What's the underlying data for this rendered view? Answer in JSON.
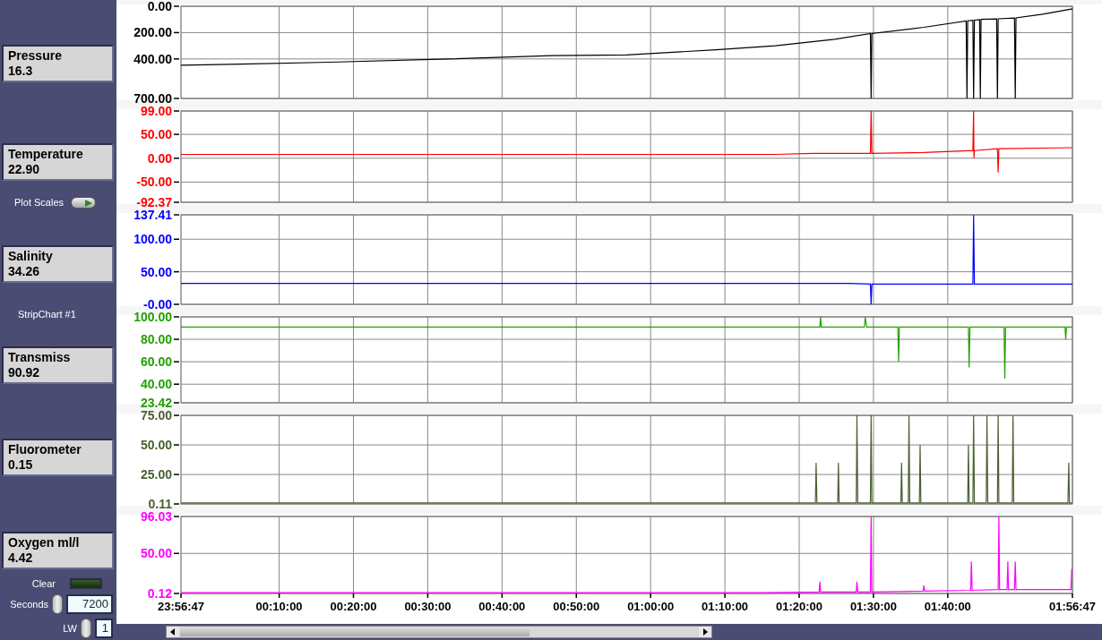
{
  "left_panel": [
    {
      "kind": "indicator",
      "label": "Pressure",
      "value": "16.3"
    },
    {
      "kind": "indicator",
      "label": "Temperature",
      "value": "22.90"
    },
    {
      "kind": "toggle",
      "label": "Plot Scales",
      "on": true
    },
    {
      "kind": "indicator",
      "label": "Salinity",
      "value": "34.26"
    },
    {
      "kind": "caption",
      "label": "StripChart #1"
    },
    {
      "kind": "indicator",
      "label": "Transmiss",
      "value": "90.92"
    },
    {
      "kind": "indicator",
      "label": "Fluorometer",
      "value": "0.15"
    },
    {
      "kind": "indicator",
      "label": "Oxygen ml/l",
      "value": "4.42"
    },
    {
      "kind": "led",
      "label": "Clear",
      "on": false
    },
    {
      "kind": "spinner",
      "label": "Seconds",
      "value": "7200"
    },
    {
      "kind": "spinner",
      "label": "LW",
      "value": "1"
    }
  ],
  "charts": [
    {
      "chart_data": {
        "type": "line",
        "grid": true,
        "xlim": [
          -193,
          7007
        ],
        "ylim": [
          700,
          0
        ],
        "yticks": [
          {
            "value": 0,
            "label": "0.00"
          },
          {
            "value": 200,
            "label": "200.00"
          },
          {
            "value": 400,
            "label": "400.00"
          },
          {
            "value": 700,
            "label": "700.00"
          }
        ],
        "x": [
          -193,
          287,
          1007,
          1967,
          2807,
          3407,
          4127,
          4607,
          5087,
          5375,
          5381,
          5387,
          5807,
          6149,
          6155,
          6161,
          6203,
          6209,
          6215,
          6257,
          6263,
          6269,
          6395,
          6401,
          6407,
          6539,
          6545,
          6551,
          6767,
          7007
        ],
        "series": [
          {
            "color": "#000000",
            "values": [
              448,
              440,
              425,
              400,
              375,
              370,
              330,
              300,
              250,
              207,
              700,
              207,
              160,
              112,
              700,
              110,
              107,
              700,
              105,
              102,
              700,
              100,
              96,
              700,
              95,
              90,
              700,
              88,
              60,
              20
            ]
          }
        ]
      }
    },
    {
      "chart_data": {
        "type": "line",
        "grid": true,
        "xlim": [
          -193,
          7007
        ],
        "ylim": [
          -92.37,
          99
        ],
        "yticks": [
          {
            "value": 99,
            "label": "99.00"
          },
          {
            "value": 50,
            "label": "50.00"
          },
          {
            "value": 0,
            "label": "0.00"
          },
          {
            "value": -50,
            "label": "-50.00"
          },
          {
            "value": -92.37,
            "label": "-92.37"
          }
        ],
        "x": [
          -193,
          4607,
          4907,
          5375,
          5381,
          5387,
          5807,
          6203,
          6209,
          6212,
          6215,
          6401,
          6407,
          6413,
          7007
        ],
        "series": [
          {
            "color": "#ff0000",
            "values": [
              8,
              8,
              10,
              10,
              99,
              10,
              12,
              16,
              99,
              0,
              16,
              20,
              -30,
              20,
              22
            ]
          }
        ]
      }
    },
    {
      "chart_data": {
        "type": "line",
        "grid": true,
        "xlim": [
          -193,
          7007
        ],
        "ylim": [
          0,
          137.41
        ],
        "yticks": [
          {
            "value": 137.41,
            "label": "137.41"
          },
          {
            "value": 100,
            "label": "100.00"
          },
          {
            "value": 50,
            "label": "50.00"
          },
          {
            "value": 0,
            "label": "-0.00"
          }
        ],
        "x": [
          -193,
          5207,
          5375,
          5381,
          5387,
          6203,
          6209,
          6215,
          7007
        ],
        "series": [
          {
            "color": "#0000ff",
            "values": [
              32,
              32,
              31,
              0,
              31,
              31,
              137,
              31,
              31
            ]
          }
        ]
      }
    },
    {
      "chart_data": {
        "type": "line",
        "grid": true,
        "xlim": [
          -193,
          7007
        ],
        "ylim": [
          23.42,
          100
        ],
        "yticks": [
          {
            "value": 100,
            "label": "100.00"
          },
          {
            "value": 80,
            "label": "80.00"
          },
          {
            "value": 60,
            "label": "60.00"
          },
          {
            "value": 40,
            "label": "40.00"
          },
          {
            "value": 23.42,
            "label": "23.42"
          }
        ],
        "x": [
          -193,
          4907,
          4967,
          4973,
          4979,
          5327,
          5333,
          5345,
          5597,
          5603,
          5609,
          6167,
          6173,
          6179,
          6455,
          6461,
          6467,
          6947,
          6953,
          6959,
          7007
        ],
        "series": [
          {
            "color": "#22a000",
            "values": [
              91,
              91,
              91,
              100,
              91,
              91,
              100,
              91,
              91,
              60,
              91,
              91,
              55,
              91,
              91,
              45,
              91,
              91,
              80,
              91,
              91
            ]
          }
        ]
      }
    },
    {
      "chart_data": {
        "type": "line",
        "grid": true,
        "xlim": [
          -193,
          7007
        ],
        "ylim": [
          0.11,
          75
        ],
        "yticks": [
          {
            "value": 75,
            "label": "75.00"
          },
          {
            "value": 50,
            "label": "50.00"
          },
          {
            "value": 25,
            "label": "25.00"
          },
          {
            "value": 0.11,
            "label": "0.11"
          }
        ],
        "x": [
          -193,
          4931,
          4937,
          4943,
          5111,
          5117,
          5123,
          5261,
          5267,
          5273,
          5375,
          5381,
          5387,
          5621,
          5627,
          5633,
          5681,
          5687,
          5693,
          5771,
          5777,
          5783,
          6161,
          6167,
          6173,
          6203,
          6209,
          6215,
          6311,
          6317,
          6323,
          6401,
          6407,
          6413,
          6521,
          6527,
          6533,
          6971,
          6977,
          6983,
          7007
        ],
        "series": [
          {
            "color": "#4a6030",
            "values": [
              1,
              1,
              35,
              1,
              1,
              35,
              1,
              1,
              75,
              1,
              1,
              75,
              1,
              1,
              35,
              1,
              1,
              75,
              1,
              1,
              50,
              1,
              1,
              50,
              1,
              1,
              75,
              1,
              1,
              75,
              1,
              1,
              75,
              1,
              1,
              75,
              1,
              1,
              35,
              1,
              1
            ]
          }
        ]
      }
    },
    {
      "chart_data": {
        "type": "line",
        "grid": true,
        "xlim": [
          -193,
          7007
        ],
        "ylim": [
          0.12,
          96.03
        ],
        "xticks": [
          {
            "value": 600,
            "label": "00:10:00"
          },
          {
            "value": 1200,
            "label": "00:20:00"
          },
          {
            "value": 1800,
            "label": "00:30:00"
          },
          {
            "value": 2400,
            "label": "00:40:00"
          },
          {
            "value": 3000,
            "label": "00:50:00"
          },
          {
            "value": 3600,
            "label": "01:00:00"
          },
          {
            "value": 4200,
            "label": "01:10:00"
          },
          {
            "value": 4800,
            "label": "01:20:00"
          },
          {
            "value": 5400,
            "label": "01:30:00"
          },
          {
            "value": 6000,
            "label": "01:40:00"
          },
          {
            "value": 7007,
            "label": "01:56:47"
          }
        ],
        "yticks": [
          {
            "value": 96.03,
            "label": "96.03"
          },
          {
            "value": 50,
            "label": "50.00"
          },
          {
            "value": 0.12,
            "label": "0.12"
          }
        ],
        "x": [
          -193,
          4487,
          4961,
          4967,
          4973,
          5261,
          5267,
          5273,
          5375,
          5381,
          5387,
          5801,
          5807,
          5813,
          6185,
          6191,
          6197,
          6407,
          6413,
          6419,
          6479,
          6485,
          6491,
          6539,
          6545,
          6551,
          6995,
          7001,
          7007
        ],
        "series": [
          {
            "color": "#ff00ff",
            "values": [
              1,
              1,
              2,
              15,
              2,
              2,
              15,
              2,
              2,
              96,
              2,
              3,
              10,
              3,
              4,
              40,
              4,
              5,
              96,
              5,
              5,
              40,
              5,
              5,
              40,
              5,
              5,
              30,
              30
            ]
          }
        ]
      },
      "axis_start_label": "23:56:47"
    }
  ]
}
